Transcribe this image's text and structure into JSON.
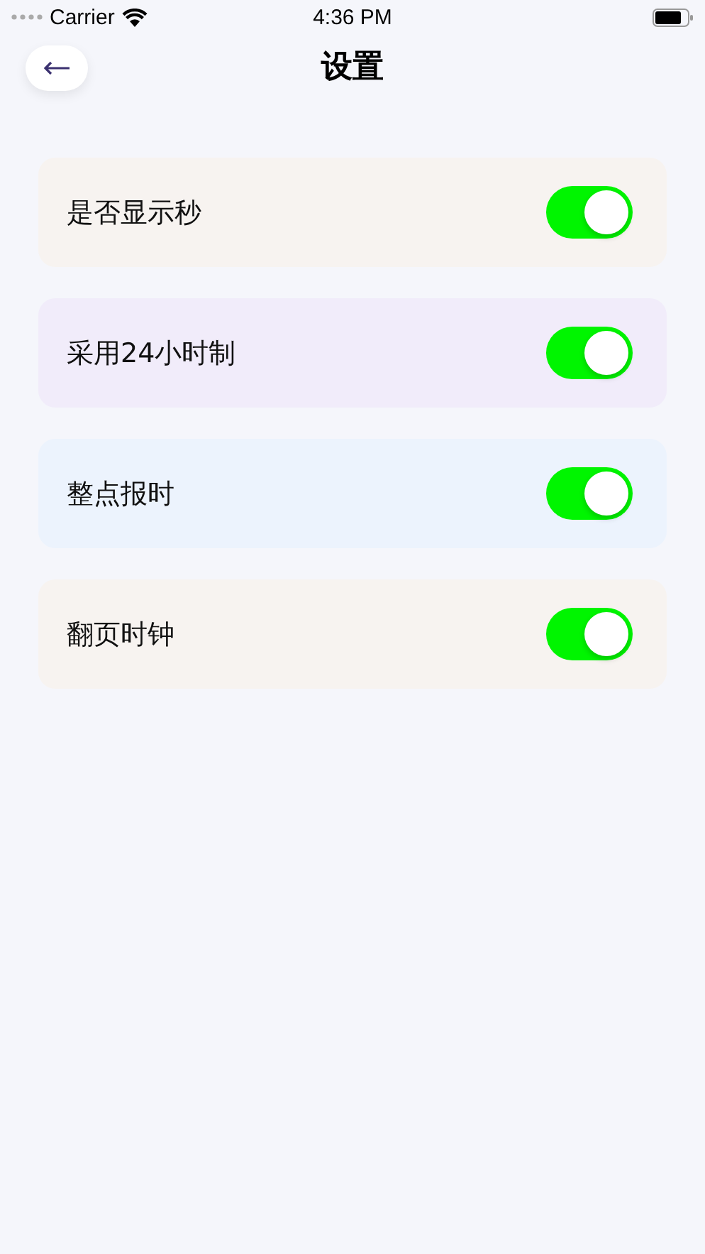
{
  "status_bar": {
    "carrier": "Carrier",
    "time": "4:36 PM"
  },
  "header": {
    "title": "设置"
  },
  "settings": [
    {
      "label": "是否显示秒",
      "on": true,
      "color": "#f7f3f0"
    },
    {
      "label": "采用24小时制",
      "on": true,
      "color": "#f1ecfa"
    },
    {
      "label": "整点报时",
      "on": true,
      "color": "#ecf3fd"
    },
    {
      "label": "翻页时钟",
      "on": true,
      "color": "#f7f3f0"
    }
  ]
}
